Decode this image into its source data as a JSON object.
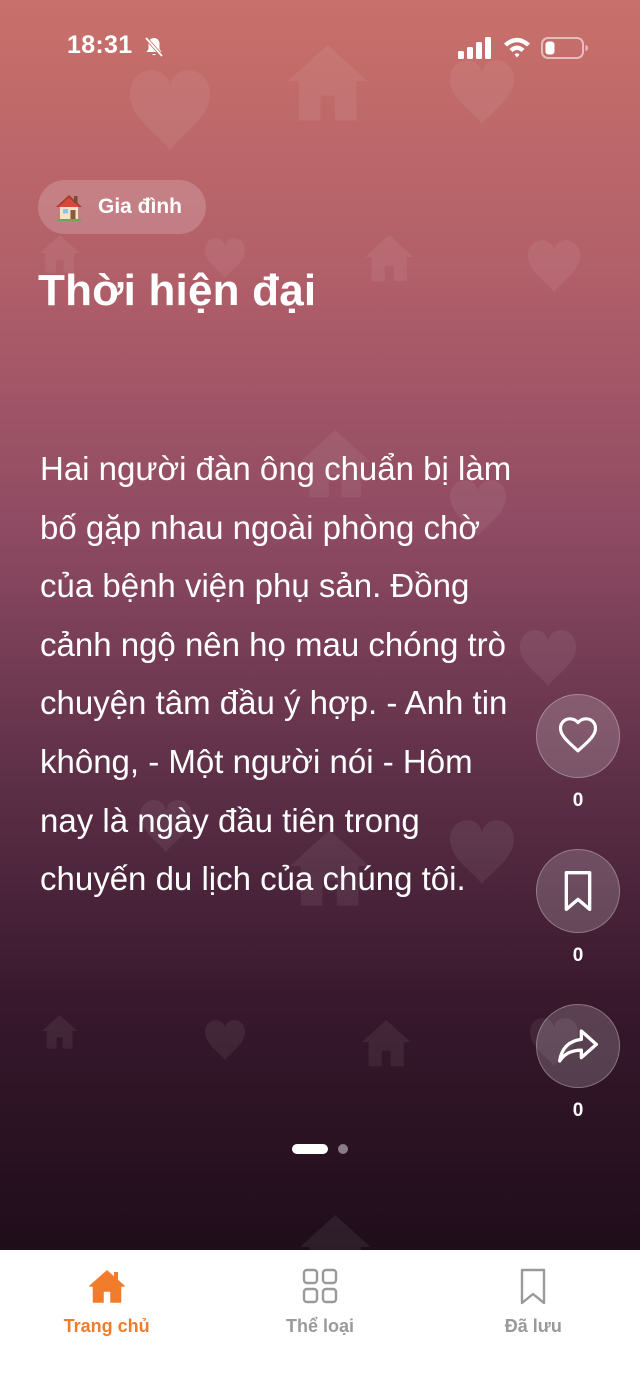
{
  "status_bar": {
    "time": "18:31",
    "icons": [
      "bell-slash-icon",
      "signal-icon",
      "wifi-icon",
      "battery-icon"
    ]
  },
  "story": {
    "category": {
      "icon": "house-emoji-icon",
      "label": "Gia đình"
    },
    "title": "Thời hiện đại",
    "body": "Hai người đàn ông chuẩn bị làm bố gặp nhau ngoài phòng chờ của bệnh viện phụ sản. Đồng cảnh ngộ nên họ mau chóng trò chuyện tâm đầu ý hợp. - Anh tin không, - Một người nói - Hôm nay là ngày đầu tiên trong chuyến du lịch của chúng tôi."
  },
  "actions": {
    "like": {
      "icon": "heart-icon",
      "count": "0"
    },
    "save": {
      "icon": "bookmark-icon",
      "count": "0"
    },
    "share": {
      "icon": "share-icon",
      "count": "0"
    }
  },
  "pagination": {
    "total": 2,
    "current": 1
  },
  "tab_bar": {
    "tabs": [
      {
        "label": "Trang chủ",
        "icon": "home-icon",
        "active": true
      },
      {
        "label": "Thể loại",
        "icon": "grid-icon",
        "active": false
      },
      {
        "label": "Đã lưu",
        "icon": "bookmark-icon",
        "active": false
      }
    ]
  },
  "colors": {
    "accent": "#f07c2c",
    "tab_inactive": "#9a9a9a",
    "gradient_top": "#c8706a",
    "gradient_bottom": "#1f0d1a"
  }
}
